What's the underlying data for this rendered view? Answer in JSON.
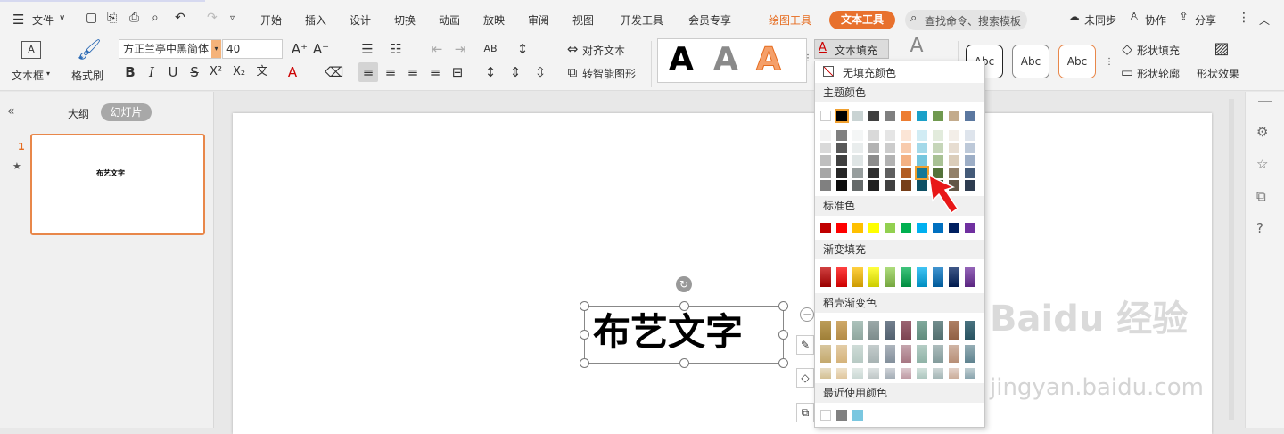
{
  "menubar": {
    "file": "文件",
    "items": [
      "开始",
      "插入",
      "设计",
      "切换",
      "动画",
      "放映",
      "审阅",
      "视图",
      "开发工具",
      "会员专享"
    ],
    "drawing_tools": "绘图工具",
    "text_tools": "文本工具",
    "search_placeholder": "查找命令、搜索模板",
    "unsynced": "未同步",
    "collab": "协作",
    "share": "分享"
  },
  "ribbon": {
    "textbox": "文本框",
    "format_painter": "格式刷",
    "font_name": "方正兰亭中黑简体",
    "font_size": "40",
    "align_text": "对齐文本",
    "smart_shape": "转智能图形",
    "text_fill": "文本填充",
    "shape_fill": "形状填充",
    "shape_outline": "形状轮廓",
    "shape_effect": "形状效果",
    "wordart_letter": "A",
    "style_labels": [
      "Abc",
      "Abc",
      "Abc"
    ],
    "bold": "B",
    "italic": "I",
    "underline": "U",
    "strike": "S",
    "superscript": "X²",
    "subscript": "X₂"
  },
  "left_panel": {
    "outline_tab": "大纲",
    "slides_tab": "幻灯片",
    "slide_number": "1",
    "thumb_text": "布艺文字"
  },
  "slide": {
    "title_text": "布艺文字"
  },
  "dropdown": {
    "no_fill": "无填充颜色",
    "theme_colors_label": "主题颜色",
    "standard_colors_label": "标准色",
    "gradient_fill_label": "渐变填充",
    "shell_gradient_label": "稻壳渐变色",
    "recent_colors_label": "最近使用颜色",
    "theme_top": [
      "#ffffff",
      "#000000",
      "#c9d3d3",
      "#404040",
      "#7f7f7f",
      "#ed7d31",
      "#1ba0c8",
      "#70994f",
      "#c3ab8c",
      "#5b78a0"
    ],
    "standard": [
      "#c00000",
      "#ff0000",
      "#ffc000",
      "#ffff00",
      "#92d050",
      "#00b050",
      "#00b0f0",
      "#0070c0",
      "#002060",
      "#7030a0"
    ],
    "recent": [
      "#ffffff",
      "#808080",
      "#7ac7e0"
    ]
  },
  "watermark": {
    "brand": "Baidu 经验",
    "url": "jingyan.baidu.com"
  }
}
